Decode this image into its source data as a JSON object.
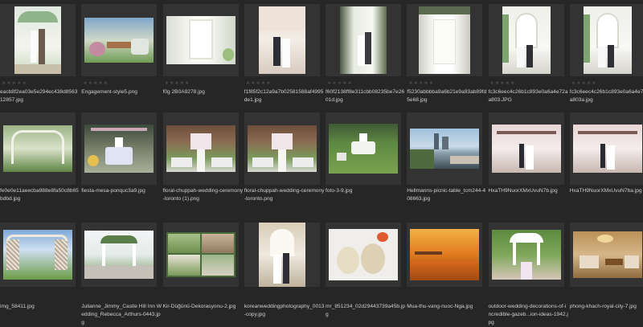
{
  "files": [
    {
      "name": "eacb8f2ea03e5e294ec438d856312857.jpg"
    },
    {
      "name": "Engagement-style5.png"
    },
    {
      "name": "f0g 2B0A9278.jpg"
    },
    {
      "name": "f1f85f2c12a9a7b02581588af4995de1.jpg"
    },
    {
      "name": "f60f2138ff8e311cbb08235be7e2601d.jpg"
    },
    {
      "name": "f5230abbbba9a6b21e9a93ab89fd5e68.jpg"
    },
    {
      "name": "fc3c6eec4c26b1c893e0a6a4e72aa803.JPG"
    },
    {
      "name": "fc3c6eec4c26b1c893e0a6a4e72aa803a.jpg"
    },
    {
      "name": "fe0e0e11aeecba988e8fa50c8b65bdbd.jpg"
    },
    {
      "name": "fiesta-mesa-ponquc3a9.jpg"
    },
    {
      "name": "floral-chuppah-wedding-ceremony-toronto (1).png"
    },
    {
      "name": "floral-chuppah-wedding-ceremony-toronto.png"
    },
    {
      "name": "foto-3-9.jpg"
    },
    {
      "name": "Hellmanns-picnic-table_tcm244-408663.jpg"
    },
    {
      "name": "HxaTH9NuorXMxUvuN7b.jpg"
    },
    {
      "name": "HxaTH9NuorXMxUvuN7ba.jpg"
    },
    {
      "name": "img_58411.jpg"
    },
    {
      "name": "Julianne_Jimmy_Castle Hill Inn Wedding_Rebecca_Arthurs-0443.jpg"
    },
    {
      "name": "Kir-Düğünü-Dekorasyonu-2.jpg"
    },
    {
      "name": "koreanweddingphotography_0013-copy.jpg"
    },
    {
      "name": "mr_851234_02d29443739a45b.jpg"
    },
    {
      "name": "Mua-thu-vang-nuoc-Nga.jpg"
    },
    {
      "name": "outdoor-wedding-decorations-of-incredible-gazeb...ion-ideas-1942.jpg"
    },
    {
      "name": "phong-khach-royal-city-7.jpg"
    }
  ],
  "rating_stars": "★★★★★",
  "thumbnails": [
    {
      "icon": "wedding-arch-couple-thumbnail"
    },
    {
      "icon": "engagement-table-thumbnail"
    },
    {
      "icon": "bright-window-thumbnail"
    },
    {
      "icon": "cherry-blossom-couple-thumbnail"
    },
    {
      "icon": "window-couple-thumbnail"
    },
    {
      "icon": "white-window-curtains-thumbnail"
    },
    {
      "icon": "arched-window-couple-thumbnail"
    },
    {
      "icon": "arched-window-couple-alt-thumbnail"
    },
    {
      "icon": "floral-arch-garden-thumbnail"
    },
    {
      "icon": "cake-table-thumbnail"
    },
    {
      "icon": "chuppah-aisle-thumbnail"
    },
    {
      "icon": "chuppah-aisle-alt-thumbnail"
    },
    {
      "icon": "lawn-cake-table-thumbnail"
    },
    {
      "icon": "waterfront-city-thumbnail"
    },
    {
      "icon": "blossom-tree-couple-thumbnail"
    },
    {
      "icon": "blossom-tree-couple-alt-thumbnail"
    },
    {
      "icon": "lattice-arch-lawn-thumbnail"
    },
    {
      "icon": "castle-gazebo-thumbnail"
    },
    {
      "icon": "garden-decor-collage-thumbnail"
    },
    {
      "icon": "studio-couple-thumbnail"
    },
    {
      "icon": "teddy-bears-thumbnail"
    },
    {
      "icon": "autumn-path-thumbnail"
    },
    {
      "icon": "outdoor-gazebo-aisle-thumbnail"
    },
    {
      "icon": "royal-living-room-thumbnail"
    }
  ]
}
